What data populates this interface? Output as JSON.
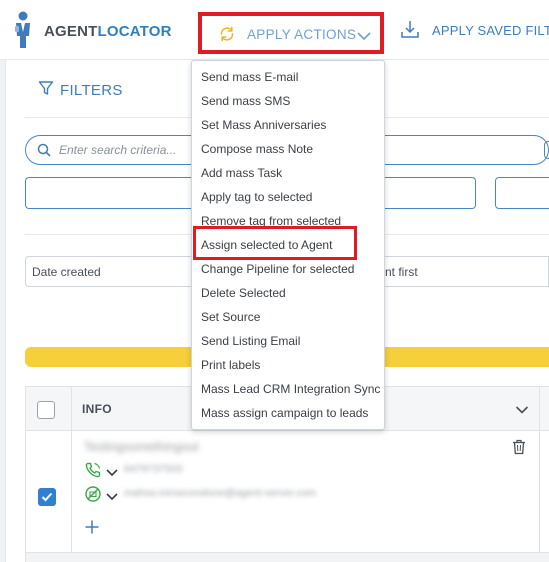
{
  "header": {
    "brand_part1": "AGENT",
    "brand_part2": "LOCATOR",
    "apply_actions_label": "APPLY ACTIONS",
    "apply_saved_label": "APPLY SAVED FILTE"
  },
  "filters": {
    "title": "FILTERS",
    "search_placeholder": "Enter search criteria...",
    "sort_field": "Date created",
    "sort_order": "nt first"
  },
  "table": {
    "header_info": "INFO",
    "rows": [
      {
        "name": "Testingsomethingout",
        "phone": "6479737503",
        "email": "mahsa.mirsecondone@agent-server.com",
        "selected": true
      }
    ]
  },
  "menu": {
    "items": [
      "Send mass E-mail",
      "Send mass SMS",
      "Set Mass Anniversaries",
      "Compose mass Note",
      "Add mass Task",
      "Apply tag to selected",
      "Remove tag from selected",
      "Assign selected to Agent",
      "Change Pipeline for selected",
      "Delete Selected",
      "Set Source",
      "Send Listing Email",
      "Print labels",
      "Mass Lead CRM Integration Sync",
      "Mass assign campaign to leads"
    ],
    "highlighted_item": "Assign selected to Agent"
  },
  "colors": {
    "accent_blue": "#3e7cbf",
    "highlight_red": "#e01b24",
    "banner_yellow": "#f7cf3a",
    "checkbox_blue": "#2f7fd3",
    "phone_green": "#3aa845"
  }
}
